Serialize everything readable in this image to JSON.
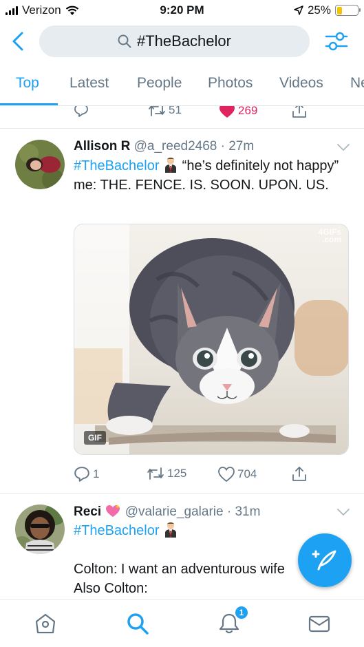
{
  "status_bar": {
    "carrier": "Verizon",
    "time": "9:20 PM",
    "battery_percent_label": "25%",
    "battery_level": 0.25
  },
  "search": {
    "query": "#TheBachelor"
  },
  "tabs": [
    {
      "label": "Top",
      "active": true
    },
    {
      "label": "Latest"
    },
    {
      "label": "People"
    },
    {
      "label": "Photos"
    },
    {
      "label": "Videos"
    },
    {
      "label": "News"
    }
  ],
  "previous_tweet_actions": {
    "retweets": "51",
    "likes": "269"
  },
  "tweets": [
    {
      "name": "Allison R",
      "handle": "@a_reed2468",
      "time": "27m",
      "hashtag": "#TheBachelor",
      "text": " “he’s definitely not happy” me: THE. FENCE. IS. SOON. UPON. US.",
      "media": {
        "badge": "GIF",
        "watermark_line1": "4GIFs",
        "watermark_line2": ".com"
      },
      "replies": "1",
      "retweets": "125",
      "likes": "704"
    },
    {
      "name": "Reci",
      "handle": "@valarie_galarie",
      "time": "31m",
      "hashtag": "#TheBachelor",
      "line1": "Colton: I want an adventurous wife",
      "line2": "Also Colton:"
    }
  ],
  "notifications_badge": "1",
  "colors": {
    "accent": "#1da1f2",
    "like": "#e0245e",
    "secondary_text": "#657786"
  },
  "icons": [
    "signal-icon",
    "wifi-icon",
    "location-arrow-icon",
    "battery-icon",
    "back-chevron-icon",
    "search-icon",
    "filter-sliders-icon",
    "reply-icon",
    "retweet-icon",
    "heart-icon",
    "share-icon",
    "chevron-down-icon",
    "compose-icon",
    "home-icon",
    "explore-search-icon",
    "notifications-bell-icon",
    "messages-envelope-icon"
  ]
}
